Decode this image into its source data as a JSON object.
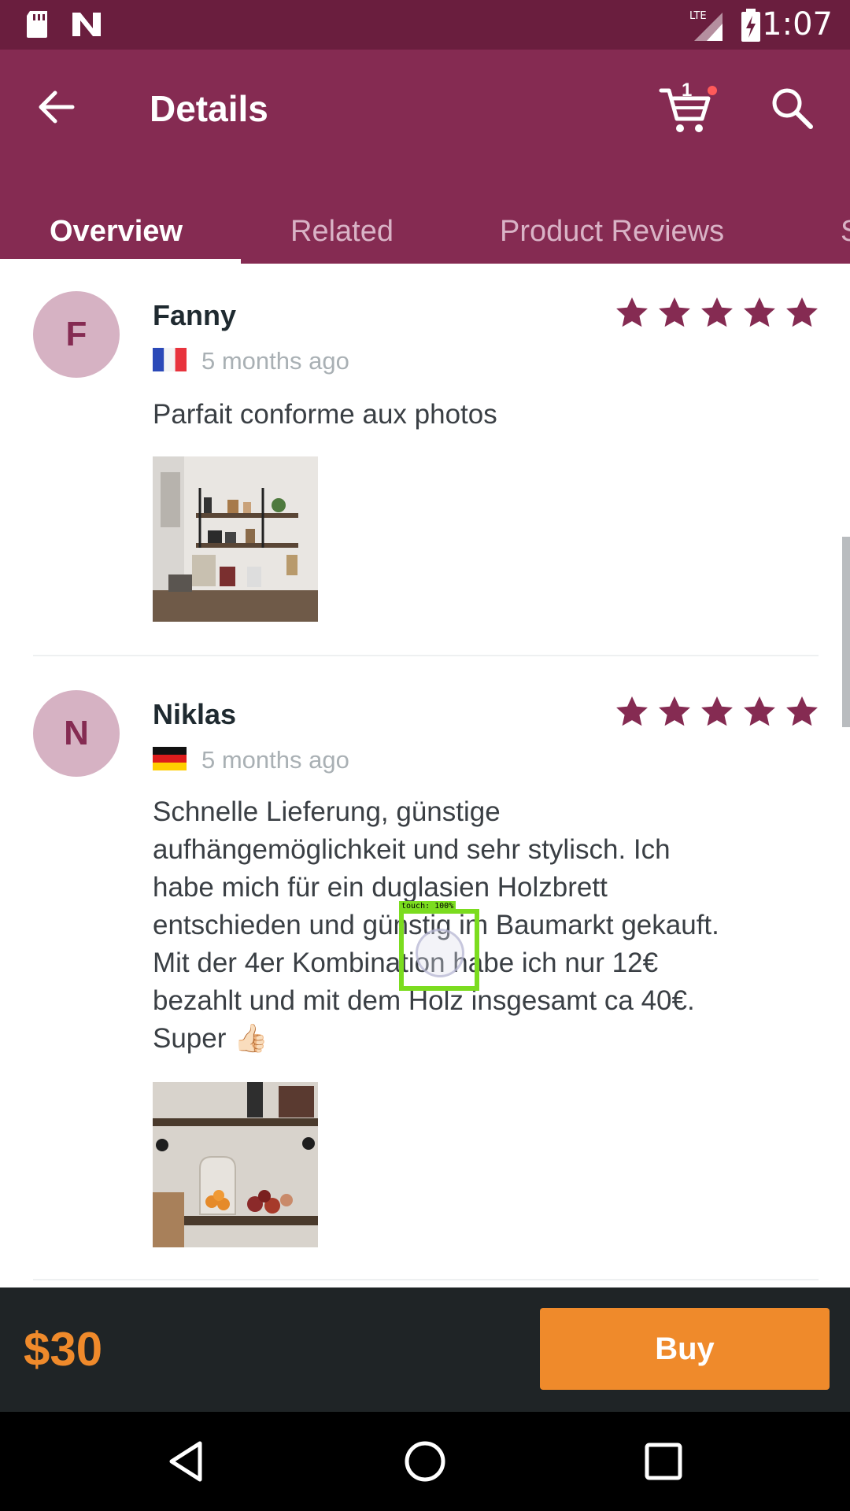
{
  "status_bar": {
    "time": "1:07",
    "icons": [
      "sd-card-icon",
      "n-logo-icon",
      "lte-signal-icon",
      "battery-charging-icon"
    ]
  },
  "app_bar": {
    "title": "Details",
    "cart_count": "1"
  },
  "tabs": [
    {
      "label": "Overview",
      "active": true
    },
    {
      "label": "Related",
      "active": false
    },
    {
      "label": "Product Reviews",
      "active": false
    },
    {
      "label": "S",
      "active": false
    }
  ],
  "reviews": [
    {
      "initial": "F",
      "name": "Fanny",
      "flag": "france-flag",
      "time": "5 months ago",
      "rating": 5,
      "text": "Parfait conforme aux photos"
    },
    {
      "initial": "N",
      "name": "Niklas",
      "flag": "germany-flag",
      "time": "5 months ago",
      "rating": 5,
      "text_lines": [
        "Schnelle Lieferung, günstige",
        "aufhängemöglichkeit und sehr stylisch. Ich",
        "habe mich für ein duglasien Holzbrett",
        "entschieden und günstig im Baumarkt gekauft.",
        "Mit der 4er Kombination habe ich nur 12€",
        "bezahlt und mit dem Holz insgesamt ca 40€.",
        "Super 👍🏻"
      ]
    }
  ],
  "touch_overlay": {
    "label": "touch: 100%"
  },
  "buy_bar": {
    "price": "$30",
    "buy_label": "Buy"
  },
  "colors": {
    "primary": "#852b52",
    "status_bar": "#6a1e3e",
    "star": "#852b52",
    "accent": "#ef8a2b",
    "buy_bar_bg": "#1f2426"
  }
}
